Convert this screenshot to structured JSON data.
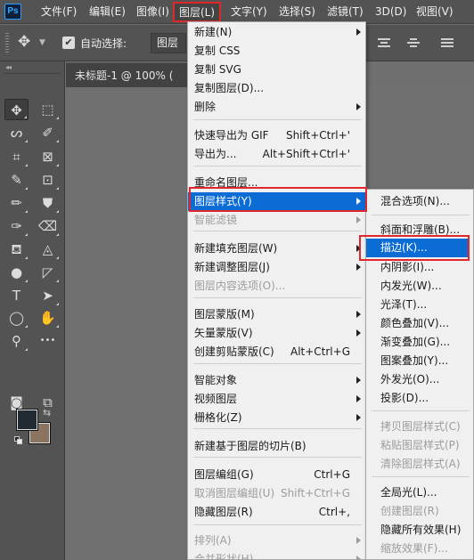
{
  "menubar": {
    "logo": "Ps",
    "items": [
      "文件(F)",
      "编辑(E)",
      "图像(I)",
      "图层(L)",
      "文字(Y)",
      "选择(S)",
      "滤镜(T)",
      "3D(D)",
      "视图(V)"
    ]
  },
  "options_bar": {
    "auto_select_label": "自动选择:",
    "auto_select_checked": true,
    "target_value": "图层"
  },
  "document": {
    "tab_title": "未标题-1 @ 100% ("
  },
  "tools": [
    {
      "name": "move-tool",
      "glyph": "✥"
    },
    {
      "name": "marquee-tool",
      "glyph": "⬚"
    },
    {
      "name": "lasso-tool",
      "glyph": "ᔕ"
    },
    {
      "name": "quick-select-tool",
      "glyph": "✐"
    },
    {
      "name": "crop-tool",
      "glyph": "⌗"
    },
    {
      "name": "frame-tool",
      "glyph": "⊠"
    },
    {
      "name": "eyedropper-tool",
      "glyph": "✎"
    },
    {
      "name": "patch-tool",
      "glyph": "⊡"
    },
    {
      "name": "brush-tool",
      "glyph": "✏"
    },
    {
      "name": "stamp-tool",
      "glyph": "⛊"
    },
    {
      "name": "history-brush-tool",
      "glyph": "✑"
    },
    {
      "name": "eraser-tool",
      "glyph": "⌫"
    },
    {
      "name": "bucket-tool",
      "glyph": "⛾"
    },
    {
      "name": "blur-tool",
      "glyph": "◬"
    },
    {
      "name": "dodge-tool",
      "glyph": "●"
    },
    {
      "name": "pen-tool",
      "glyph": "◸"
    },
    {
      "name": "type-tool",
      "glyph": "T"
    },
    {
      "name": "path-select-tool",
      "glyph": "➤"
    },
    {
      "name": "ellipse-tool",
      "glyph": "◯"
    },
    {
      "name": "hand-tool",
      "glyph": "✋"
    },
    {
      "name": "zoom-tool",
      "glyph": "⚲"
    },
    {
      "name": "more-tools",
      "glyph": "•••"
    },
    {
      "name": "quick-mask-tool",
      "glyph": "◙"
    },
    {
      "name": "screen-mode-tool",
      "glyph": "⧉"
    }
  ],
  "colors": {
    "foreground": "#222b33",
    "background": "#8b7560",
    "highlight": "#0b6cd6",
    "annotation": "#e0282c"
  },
  "layer_menu": {
    "items": [
      {
        "label": "新建(N)",
        "shortcut": "",
        "submenu": true,
        "disabled": false
      },
      {
        "label": "复制 CSS",
        "shortcut": "",
        "submenu": false,
        "disabled": false
      },
      {
        "label": "复制 SVG",
        "shortcut": "",
        "submenu": false,
        "disabled": false
      },
      {
        "label": "复制图层(D)...",
        "shortcut": "",
        "submenu": false,
        "disabled": false
      },
      {
        "label": "删除",
        "shortcut": "",
        "submenu": true,
        "disabled": false
      },
      {
        "label": "快速导出为 GIF",
        "shortcut": "Shift+Ctrl+'",
        "submenu": false,
        "disabled": false
      },
      {
        "label": "导出为...",
        "shortcut": "Alt+Shift+Ctrl+'",
        "submenu": false,
        "disabled": false
      },
      {
        "label": "重命名图层...",
        "shortcut": "",
        "submenu": false,
        "disabled": false
      },
      {
        "label": "图层样式(Y)",
        "shortcut": "",
        "submenu": true,
        "disabled": false,
        "highlighted": true
      },
      {
        "label": "智能滤镜",
        "shortcut": "",
        "submenu": true,
        "disabled": true
      },
      {
        "label": "新建填充图层(W)",
        "shortcut": "",
        "submenu": true,
        "disabled": false
      },
      {
        "label": "新建调整图层(J)",
        "shortcut": "",
        "submenu": true,
        "disabled": false
      },
      {
        "label": "图层内容选项(O)...",
        "shortcut": "",
        "submenu": false,
        "disabled": true
      },
      {
        "label": "图层蒙版(M)",
        "shortcut": "",
        "submenu": true,
        "disabled": false
      },
      {
        "label": "矢量蒙版(V)",
        "shortcut": "",
        "submenu": true,
        "disabled": false
      },
      {
        "label": "创建剪贴蒙版(C)",
        "shortcut": "Alt+Ctrl+G",
        "submenu": false,
        "disabled": false
      },
      {
        "label": "智能对象",
        "shortcut": "",
        "submenu": true,
        "disabled": false
      },
      {
        "label": "视频图层",
        "shortcut": "",
        "submenu": true,
        "disabled": false
      },
      {
        "label": "栅格化(Z)",
        "shortcut": "",
        "submenu": true,
        "disabled": false
      },
      {
        "label": "新建基于图层的切片(B)",
        "shortcut": "",
        "submenu": false,
        "disabled": false
      },
      {
        "label": "图层编组(G)",
        "shortcut": "Ctrl+G",
        "submenu": false,
        "disabled": false
      },
      {
        "label": "取消图层编组(U)",
        "shortcut": "Shift+Ctrl+G",
        "submenu": false,
        "disabled": true
      },
      {
        "label": "隐藏图层(R)",
        "shortcut": "Ctrl+,",
        "submenu": false,
        "disabled": false
      },
      {
        "label": "排列(A)",
        "shortcut": "",
        "submenu": true,
        "disabled": true
      },
      {
        "label": "合并形状(H)",
        "shortcut": "",
        "submenu": true,
        "disabled": true
      }
    ]
  },
  "style_submenu": {
    "items": [
      {
        "label": "混合选项(N)...",
        "disabled": false
      },
      {
        "label": "斜面和浮雕(B)...",
        "disabled": false
      },
      {
        "label": "描边(K)...",
        "disabled": false,
        "highlighted": true
      },
      {
        "label": "内阴影(I)...",
        "disabled": false
      },
      {
        "label": "内发光(W)...",
        "disabled": false
      },
      {
        "label": "光泽(T)...",
        "disabled": false
      },
      {
        "label": "颜色叠加(V)...",
        "disabled": false
      },
      {
        "label": "渐变叠加(G)...",
        "disabled": false
      },
      {
        "label": "图案叠加(Y)...",
        "disabled": false
      },
      {
        "label": "外发光(O)...",
        "disabled": false
      },
      {
        "label": "投影(D)...",
        "disabled": false
      },
      {
        "label": "拷贝图层样式(C)",
        "disabled": true
      },
      {
        "label": "粘贴图层样式(P)",
        "disabled": true
      },
      {
        "label": "清除图层样式(A)",
        "disabled": true
      },
      {
        "label": "全局光(L)...",
        "disabled": false
      },
      {
        "label": "创建图层(R)",
        "disabled": true
      },
      {
        "label": "隐藏所有效果(H)",
        "disabled": false
      },
      {
        "label": "缩放效果(F)...",
        "disabled": true
      }
    ]
  }
}
